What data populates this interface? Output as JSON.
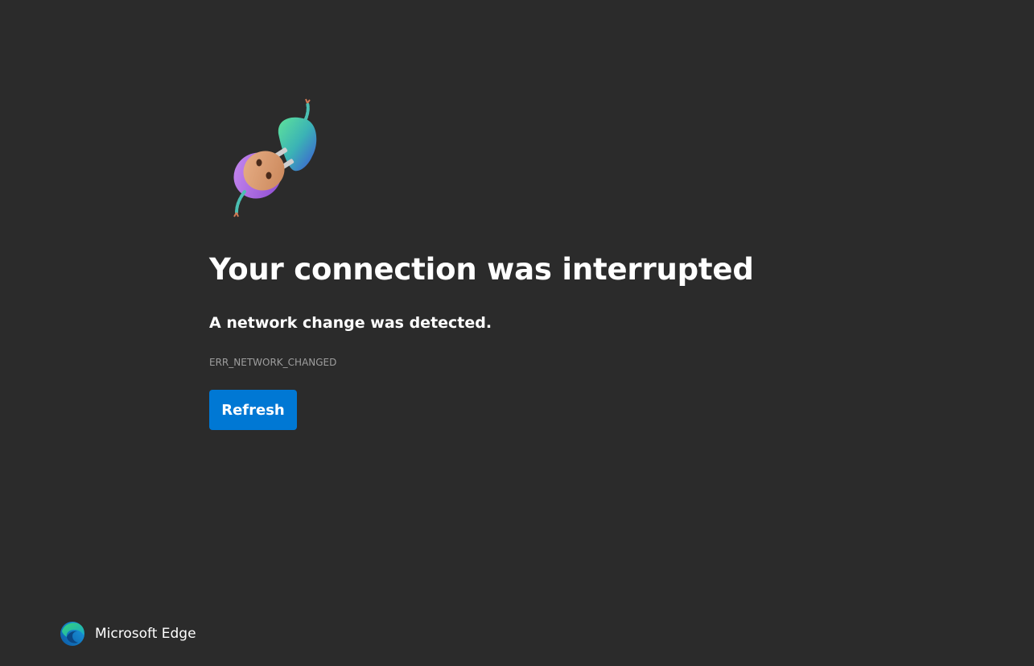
{
  "page": {
    "background_color": "#2b2b2b"
  },
  "error": {
    "illustration_icon": "unplugged-plug-icon",
    "title": "Your connection was interrupted",
    "subtitle": "A network change was detected.",
    "code": "ERR_NETWORK_CHANGED"
  },
  "actions": {
    "refresh_label": "Refresh",
    "refresh_color": "#0078d4"
  },
  "footer": {
    "logo_icon": "microsoft-edge-logo-icon",
    "brand_name": "Microsoft Edge"
  }
}
